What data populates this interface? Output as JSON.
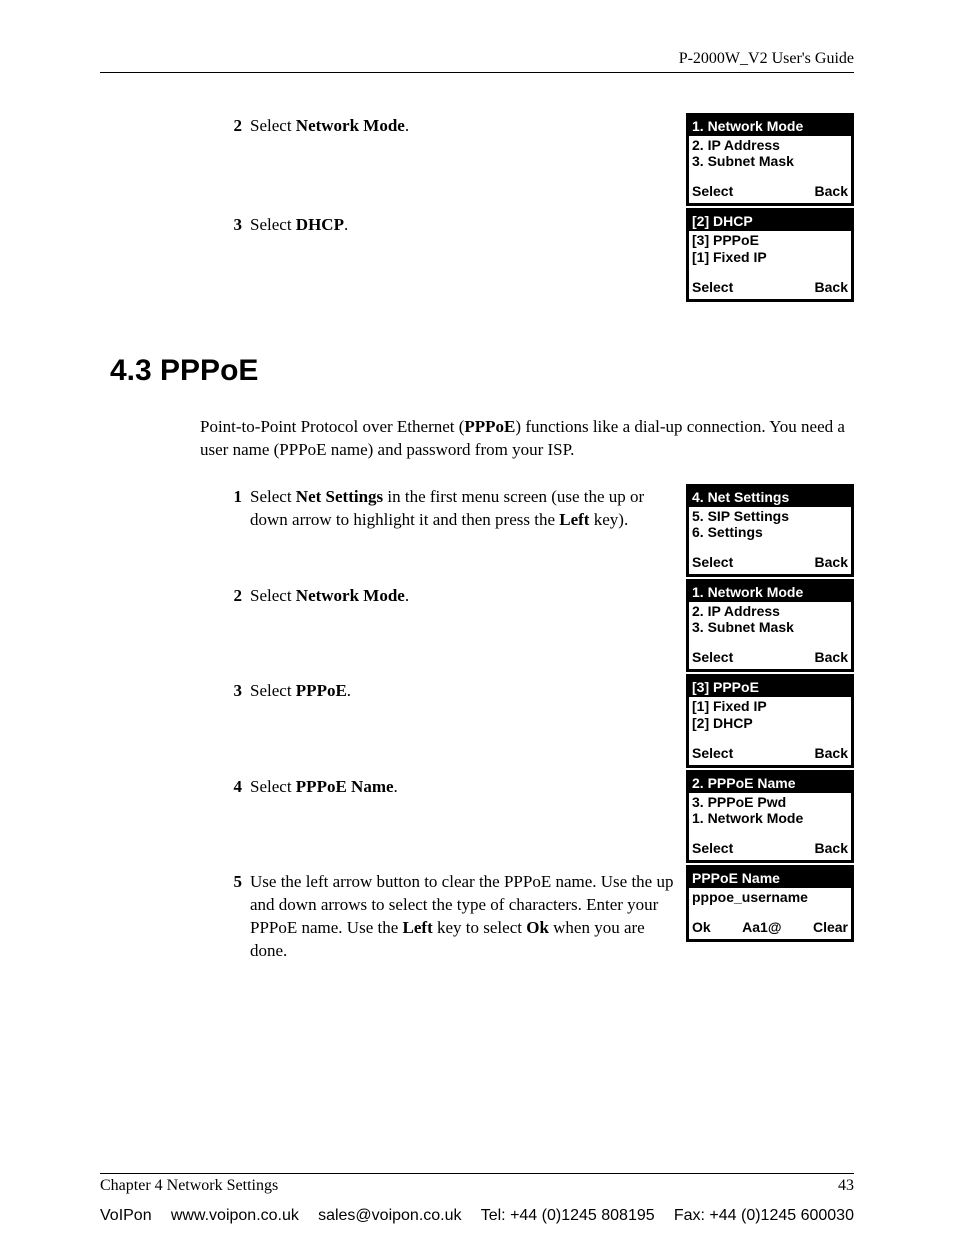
{
  "header": {
    "product_guide": "P-2000W_V2 User's Guide"
  },
  "section_a": {
    "step2": {
      "num": "2",
      "label_prefix": "Select ",
      "bold": "Network Mode",
      "suffix": "."
    },
    "step3": {
      "num": "3",
      "label_prefix": "Select ",
      "bold": "DHCP",
      "suffix": "."
    },
    "phone2": {
      "title": "1. Network Mode",
      "l1": "2. IP Address",
      "l2": "3. Subnet Mask",
      "sk_left": "Select",
      "sk_right": "Back"
    },
    "phone3": {
      "title": "[2] DHCP",
      "l1": "[3] PPPoE",
      "l2": "[1] Fixed IP",
      "sk_left": "Select",
      "sk_right": "Back"
    }
  },
  "heading": "4.3  PPPoE",
  "intro": {
    "t1": "Point-to-Point Protocol over Ethernet (",
    "b1": "PPPoE",
    "t2": ") functions like a dial-up connection. You need a user name (PPPoE name) and password from your ISP."
  },
  "section_b": {
    "step1": {
      "num": "1",
      "t1": "Select ",
      "b1": "Net Settings",
      "t2": " in the first menu screen (use the up or down arrow to highlight it and then press the ",
      "b2": "Left",
      "t3": " key)."
    },
    "phone1": {
      "title": "4. Net Settings",
      "l1": "5. SIP Settings",
      "l2": "6. Settings",
      "sk_left": "Select",
      "sk_right": "Back"
    },
    "step2": {
      "num": "2",
      "t1": "Select ",
      "b1": "Network Mode",
      "t2": "."
    },
    "phone2": {
      "title": "1. Network Mode",
      "l1": "2. IP Address",
      "l2": "3. Subnet Mask",
      "sk_left": "Select",
      "sk_right": "Back"
    },
    "step3": {
      "num": "3",
      "t1": "Select ",
      "b1": "PPPoE",
      "t2": "."
    },
    "phone3": {
      "title": "[3] PPPoE",
      "l1": "[1] Fixed IP",
      "l2": "[2] DHCP",
      "sk_left": "Select",
      "sk_right": "Back"
    },
    "step4": {
      "num": "4",
      "t1": "Select ",
      "b1": "PPPoE Name",
      "t2": "."
    },
    "phone4": {
      "title": "2. PPPoE Name",
      "l1": "3. PPPoE Pwd",
      "l2": "1. Network Mode",
      "sk_left": "Select",
      "sk_right": "Back"
    },
    "step5": {
      "num": "5",
      "t1": "Use the left arrow button to clear the PPPoE name. Use the up and down arrows to select the type of characters. Enter your PPPoE name. Use the ",
      "b1": "Left",
      "t2": " key to select ",
      "b2": "Ok",
      "t3": " when you are done."
    },
    "phone5": {
      "title": "PPPoE Name",
      "l1": "pppoe_username",
      "sk_left": "Ok",
      "sk_mid": "Aa1@",
      "sk_right": "Clear"
    }
  },
  "footer": {
    "chapter": "Chapter 4 Network Settings",
    "page": "43"
  },
  "vendor": {
    "company": "VoIPon",
    "web": "www.voipon.co.uk",
    "email": "sales@voipon.co.uk",
    "tel": "Tel: +44 (0)1245 808195",
    "fax": "Fax: +44 (0)1245 600030"
  }
}
